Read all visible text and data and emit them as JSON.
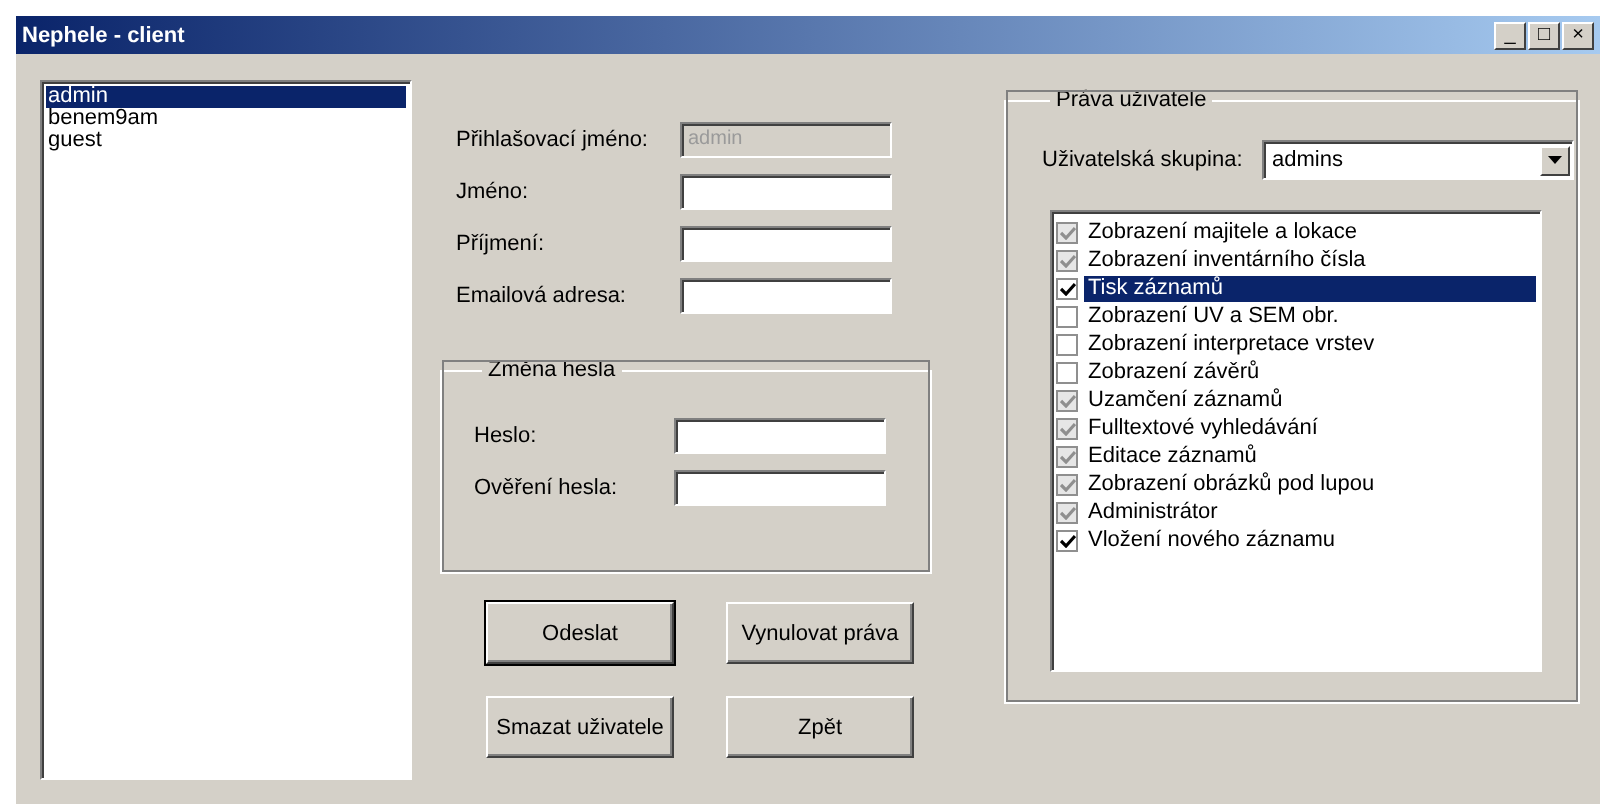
{
  "window": {
    "title": "Nephele - client",
    "controls": [
      "_",
      "□",
      "×"
    ]
  },
  "users": [
    {
      "name": "admin",
      "selected": true
    },
    {
      "name": "benem9am",
      "selected": false
    },
    {
      "name": "guest",
      "selected": false
    }
  ],
  "form": {
    "fields": [
      {
        "label": "Přihlašovací jméno:",
        "value": "admin",
        "disabled": true
      },
      {
        "label": "Jméno:",
        "disabled": false
      },
      {
        "label": "Příjmení:",
        "disabled": false
      },
      {
        "label": "Emailová adresa:",
        "disabled": false
      }
    ],
    "password_group": {
      "title": "Změna hesla",
      "fields": [
        {
          "label": "Heslo:"
        },
        {
          "label": "Ověření hesla:"
        }
      ]
    },
    "buttons": [
      {
        "label": "Odeslat",
        "default": true
      },
      {
        "label": "Vynulovat práva",
        "default": false
      },
      {
        "label": "Smazat uživatele",
        "default": false
      },
      {
        "label": "Zpět",
        "default": false
      }
    ]
  },
  "rights": {
    "title": "Práva uživatele",
    "group_label": "Uživatelská skupina:",
    "group_value": "admins",
    "permissions": [
      {
        "label": "Zobrazení majitele a lokace",
        "checked": true,
        "disabled": true,
        "selected": false
      },
      {
        "label": "Zobrazení inventárního čísla",
        "checked": true,
        "disabled": true,
        "selected": false
      },
      {
        "label": "Tisk záznamů",
        "checked": true,
        "disabled": false,
        "selected": true
      },
      {
        "label": "Zobrazení UV a SEM obr.",
        "checked": false,
        "disabled": false,
        "selected": false
      },
      {
        "label": "Zobrazení interpretace vrstev",
        "checked": false,
        "disabled": false,
        "selected": false
      },
      {
        "label": "Zobrazení závěrů",
        "checked": false,
        "disabled": false,
        "selected": false
      },
      {
        "label": "Uzamčení záznamů",
        "checked": true,
        "disabled": true,
        "selected": false
      },
      {
        "label": "Fulltextové vyhledávání",
        "checked": true,
        "disabled": true,
        "selected": false
      },
      {
        "label": "Editace záznamů",
        "checked": true,
        "disabled": true,
        "selected": false
      },
      {
        "label": "Zobrazení obrázků pod lupou",
        "checked": true,
        "disabled": true,
        "selected": false
      },
      {
        "label": "Administrátor",
        "checked": true,
        "disabled": true,
        "selected": false
      },
      {
        "label": "Vložení nového záznamu",
        "checked": true,
        "disabled": false,
        "selected": false
      }
    ]
  }
}
